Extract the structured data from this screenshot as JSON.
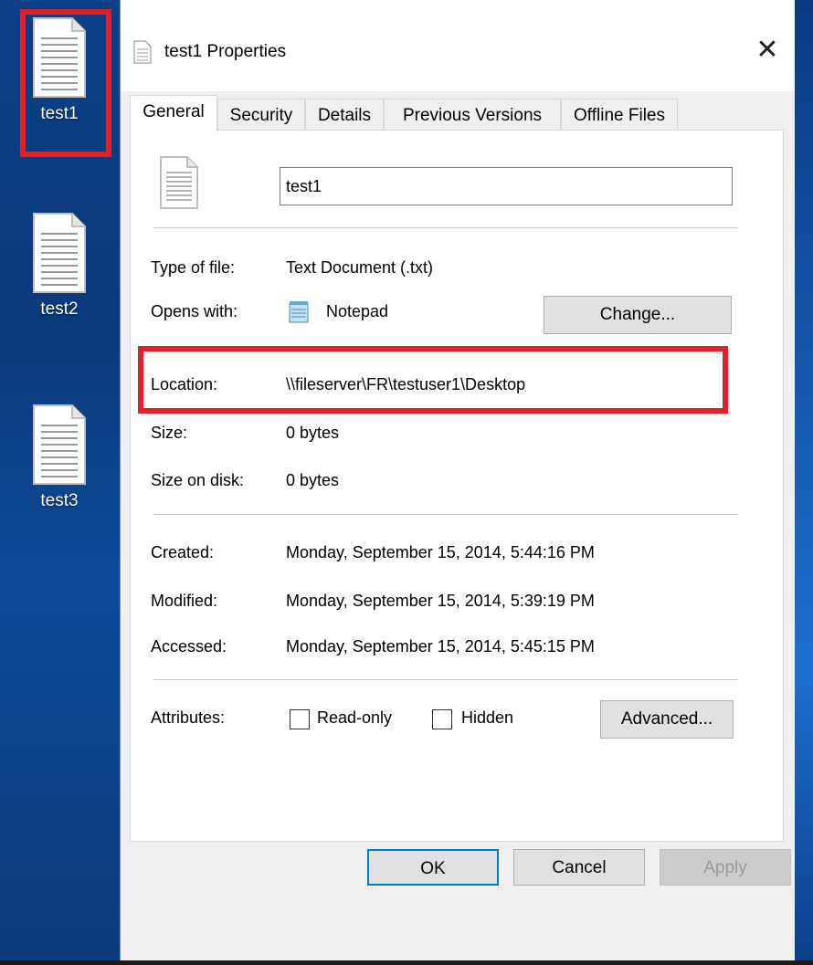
{
  "desktop": {
    "icons": [
      {
        "label": "test1"
      },
      {
        "label": "test2"
      },
      {
        "label": "test3"
      }
    ]
  },
  "dialog": {
    "title": "test1 Properties",
    "close_glyph": "✕",
    "tabs": [
      "General",
      "Security",
      "Details",
      "Previous Versions",
      "Offline Files"
    ],
    "active_tab": "General",
    "file_name": "test1",
    "type_label": "Type of file:",
    "type_value": "Text Document (.txt)",
    "opens_label": "Opens with:",
    "opens_value": "Notepad",
    "change_button": "Change...",
    "location_label": "Location:",
    "location_value": "\\\\fileserver\\FR\\testuser1\\Desktop",
    "size_label": "Size:",
    "size_value": "0 bytes",
    "size_on_disk_label": "Size on disk:",
    "size_on_disk_value": "0 bytes",
    "created_label": "Created:",
    "created_value": "Monday, September 15, 2014, 5:44:16 PM",
    "modified_label": "Modified:",
    "modified_value": "Monday, September 15, 2014, 5:39:19 PM",
    "accessed_label": "Accessed:",
    "accessed_value": "Monday, September 15, 2014, 5:45:15 PM",
    "attributes_label": "Attributes:",
    "readonly_label": "Read-only",
    "hidden_label": "Hidden",
    "advanced_button": "Advanced...",
    "ok_button": "OK",
    "cancel_button": "Cancel",
    "apply_button": "Apply"
  },
  "colors": {
    "highlight_box": "#e1202b",
    "focus_border": "#0078d7",
    "desktop_blue": "#0b3f86"
  }
}
